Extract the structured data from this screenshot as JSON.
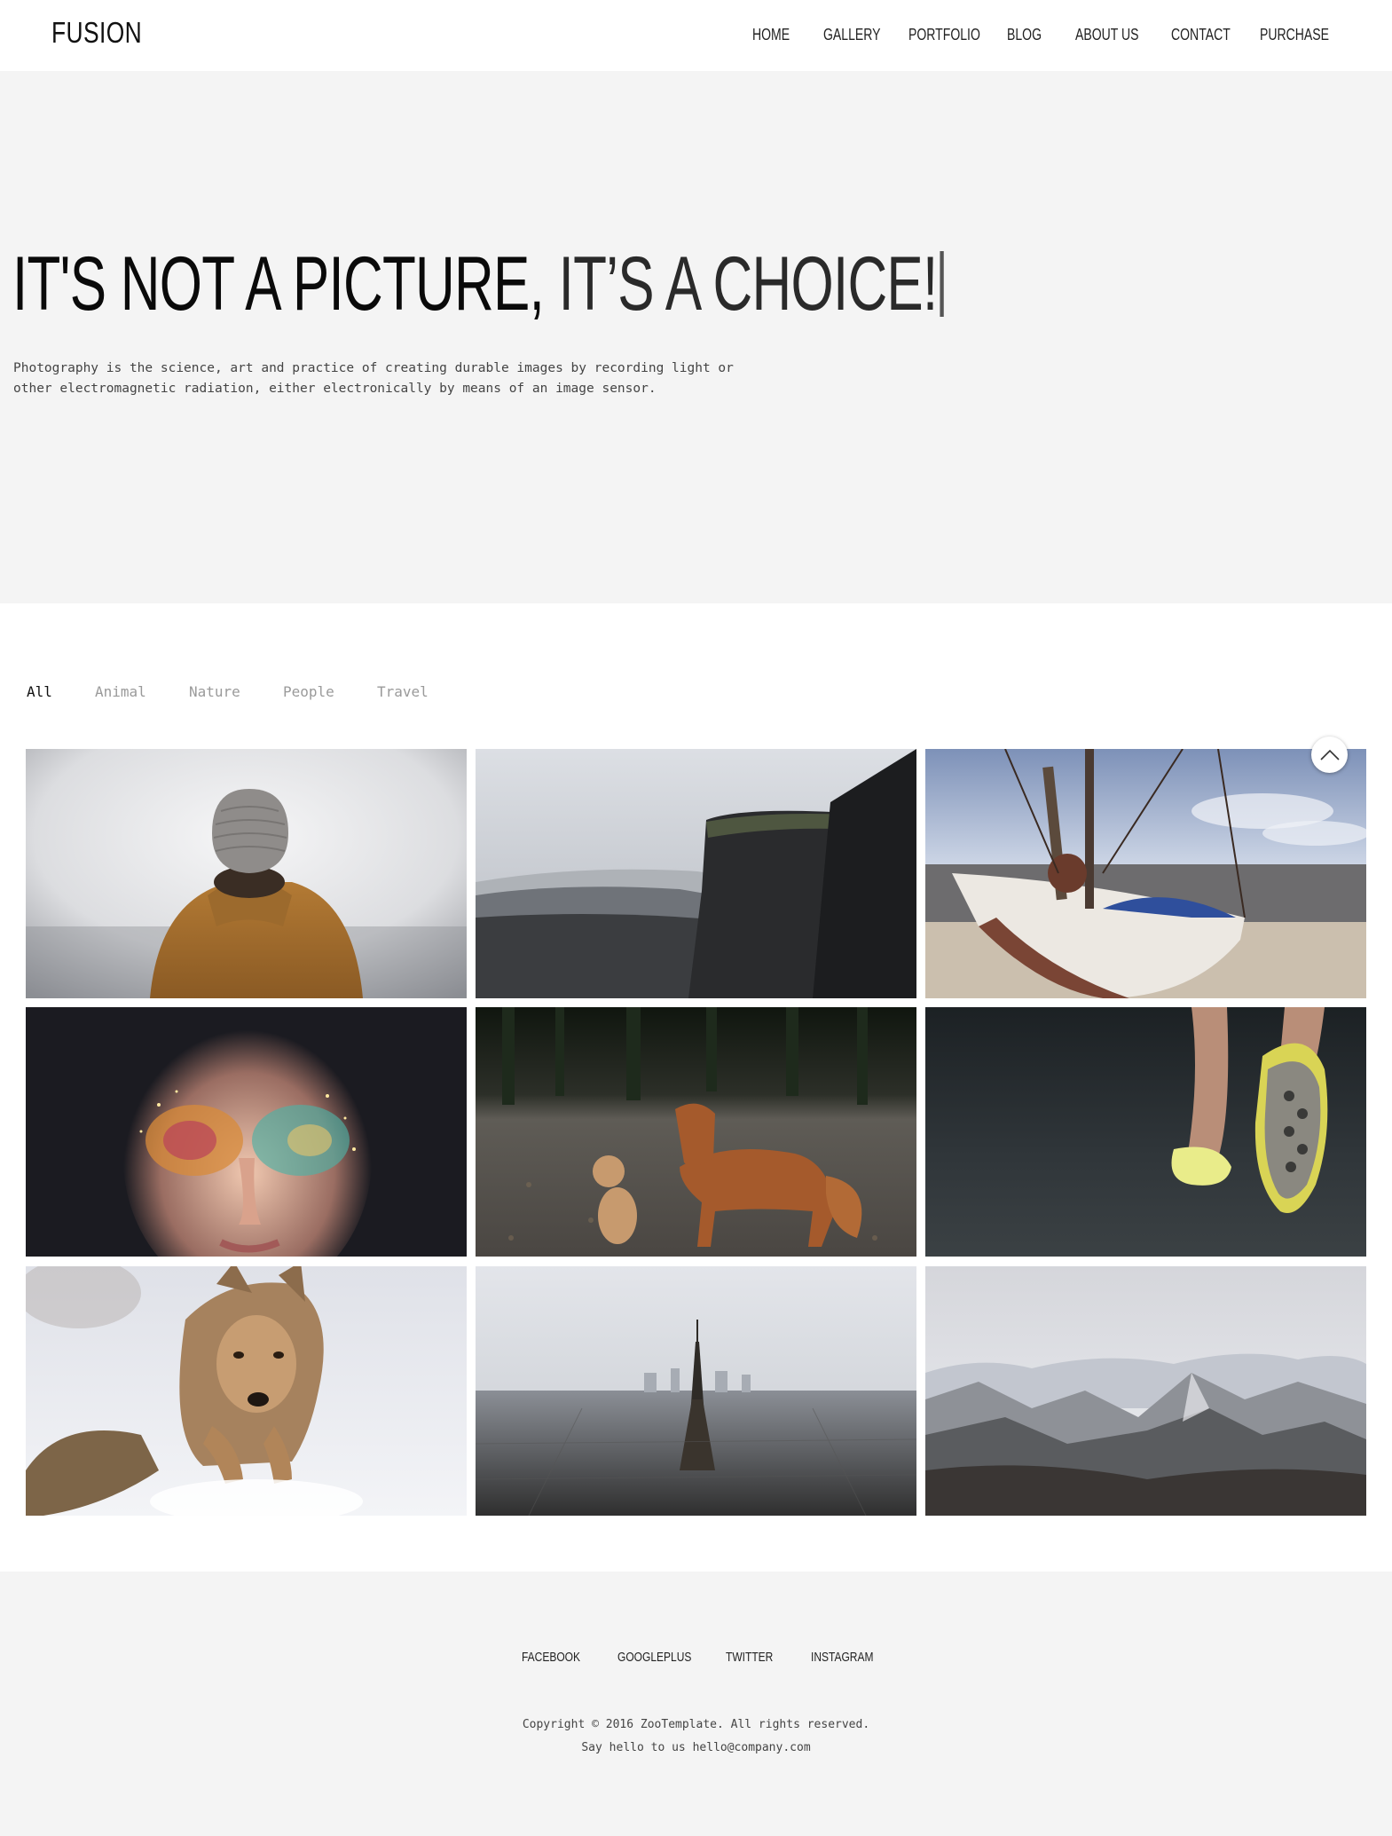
{
  "header": {
    "logo": "FUSION",
    "nav": [
      "HOME",
      "GALLERY",
      "PORTFOLIO",
      "BLOG",
      "ABOUT US",
      "CONTACT",
      "PURCHASE"
    ]
  },
  "hero": {
    "title_part1": "IT'S NOT A PICTURE,",
    "title_part2": " IT’S A CHOICE!",
    "text_line1": "Photography is the science, art and practice of creating durable images by recording light or",
    "text_line2": "other electromagnetic radiation, either electronically by means of an image sensor."
  },
  "filters": {
    "items": [
      "All",
      "Animal",
      "Nature",
      "People",
      "Travel"
    ],
    "active": "All"
  },
  "gallery": {
    "photos": [
      {
        "subject": "person-in-beanie-and-hooded-jacket"
      },
      {
        "subject": "dark-cliffs-and-valley"
      },
      {
        "subject": "boat-bow-on-beach"
      },
      {
        "subject": "face-with-glitter-makeup"
      },
      {
        "subject": "two-dogs-on-path"
      },
      {
        "subject": "running-shoes-on-road"
      },
      {
        "subject": "coyote-in-snow"
      },
      {
        "subject": "paris-eiffel-tower-skyline"
      },
      {
        "subject": "mountain-range"
      }
    ]
  },
  "footer": {
    "social": [
      "FACEBOOK",
      "GOOGLEPLUS",
      "TWITTER",
      "INSTAGRAM"
    ],
    "copyright": "Copyright © 2016 ZooTemplate. All rights reserved.",
    "contact": "Say hello to us hello@company.com"
  },
  "colors": {
    "hero_bg": "#f4f4f4",
    "footer_bg": "#f4f4f4",
    "filter_inactive": "#9a9a9a",
    "text_dark": "#111111"
  },
  "icons": {
    "scroll_top": "chevron-up-icon"
  }
}
